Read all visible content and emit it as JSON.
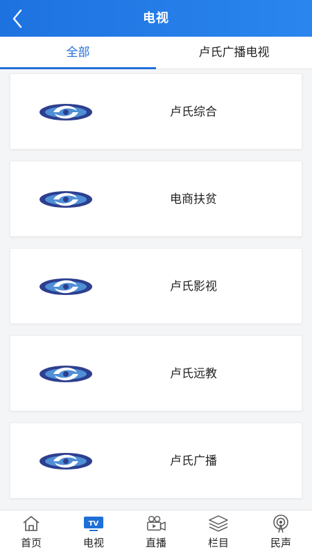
{
  "header": {
    "title": "电视",
    "back_icon": "chevron-left-icon"
  },
  "tabs": [
    {
      "label": "全部",
      "active": true
    },
    {
      "label": "卢氏广播电视",
      "active": false
    }
  ],
  "channels": [
    {
      "label": "卢氏综合",
      "logo": "swirl-logo-icon"
    },
    {
      "label": "电商扶贫",
      "logo": "swirl-logo-icon"
    },
    {
      "label": "卢氏影视",
      "logo": "swirl-logo-icon"
    },
    {
      "label": "卢氏远教",
      "logo": "swirl-logo-icon"
    },
    {
      "label": "卢氏广播",
      "logo": "swirl-logo-icon"
    }
  ],
  "tabbar": [
    {
      "label": "首页",
      "icon": "home-icon",
      "active": false
    },
    {
      "label": "电视",
      "icon": "tv-icon",
      "active": true
    },
    {
      "label": "直播",
      "icon": "video-camera-icon",
      "active": false
    },
    {
      "label": "栏目",
      "icon": "layers-icon",
      "active": false
    },
    {
      "label": "民声",
      "icon": "broadcast-icon",
      "active": false
    }
  ],
  "colors": {
    "header_blue": "#1e72e0",
    "active_blue": "#1f6fd8",
    "logo_navy": "#2d3f8f",
    "logo_light": "#4f8fd6"
  }
}
